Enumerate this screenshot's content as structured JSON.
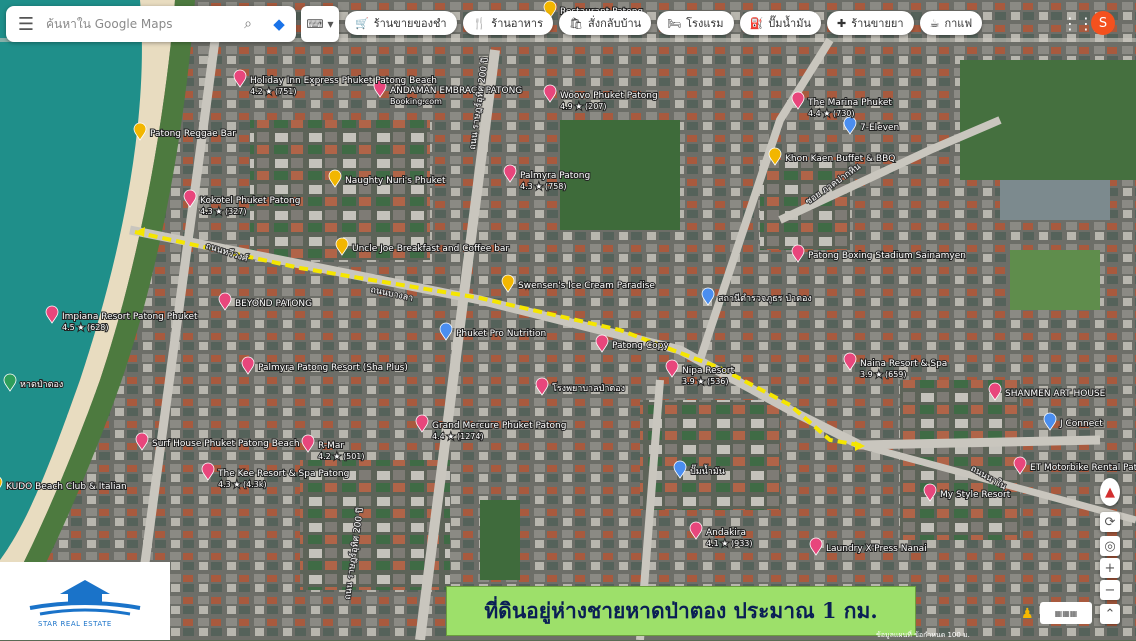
{
  "search": {
    "placeholder": "ค้นหาใน Google Maps"
  },
  "chips": [
    {
      "icon": "cart-icon",
      "glyph": "🛒",
      "label": "ร้านขายของชำ"
    },
    {
      "icon": "restaurant-icon",
      "glyph": "🍴",
      "label": "ร้านอาหาร"
    },
    {
      "icon": "takeout-icon",
      "glyph": "🛍",
      "label": "สั่งกลับบ้าน"
    },
    {
      "icon": "hotel-icon",
      "glyph": "🛏",
      "label": "โรงแรม"
    },
    {
      "icon": "gas-icon",
      "glyph": "⛽",
      "label": "ปั๊มน้ำมัน"
    },
    {
      "icon": "pharmacy-icon",
      "glyph": "✚",
      "label": "ร้านขายยา"
    },
    {
      "icon": "coffee-icon",
      "glyph": "☕",
      "label": "กาแฟ"
    }
  ],
  "user": {
    "initial": "S"
  },
  "banner": {
    "text": "ที่ดินอยู่ห่างชายหาดป่าตอง ประมาณ 1 กม."
  },
  "logo": {
    "text": "STAR REAL ESTATE"
  },
  "attribution": {
    "text": "ข้อมูลแผนที่  ข้อกำหนด  100 ม."
  },
  "colors": {
    "route": "#f5e600",
    "pin": "#e8467c",
    "pin_yellow": "#f2b600",
    "pin_blue": "#4a8ef0",
    "sea": "#1f8f8a",
    "sand": "#e8dcc0"
  },
  "map": {
    "places": [
      {
        "name": "Holiday Inn Express Phuket Patong Beach",
        "line2": "4.2 ★ (751)"
      },
      {
        "name": "ANDAMAN EMBRACE PATONG",
        "line2": "Booking.com"
      },
      {
        "name": "Woovo Phuket Patong",
        "line2": "4.9 ★ (207)"
      },
      {
        "name": "Patong Reggae Bar",
        "line2": ""
      },
      {
        "name": "Palmyra Patong",
        "line2": "4.3 ★ (758)"
      },
      {
        "name": "Naughty Nuri's Phuket",
        "line2": ""
      },
      {
        "name": "Kokotel Phuket Patong",
        "line2": "4.3 ★ (327)"
      },
      {
        "name": "Uncle Joe Breakfast and Coffee bar",
        "line2": ""
      },
      {
        "name": "Swensen's Ice Cream Paradise",
        "line2": ""
      },
      {
        "name": "BEYOND PATONG",
        "line2": ""
      },
      {
        "name": "Impiana Resort Patong Phuket",
        "line2": "4.5 ★ (628)"
      },
      {
        "name": "Phuket Pro Nutrition",
        "line2": ""
      },
      {
        "name": "Patong Copy",
        "line2": ""
      },
      {
        "name": "Nipa Resort",
        "line2": "3.9 ★ (536)"
      },
      {
        "name": "Palmyra Patong Resort (Sha Plus)",
        "line2": ""
      },
      {
        "name": "The Marina Phuket",
        "line2": "4.4 ★ (730)"
      },
      {
        "name": "7-Eleven",
        "line2": ""
      },
      {
        "name": "Khon Kaen Buffet & BBQ",
        "line2": ""
      },
      {
        "name": "Patong Boxing Stadium Sainamyen",
        "line2": ""
      },
      {
        "name": "Naina Resort & Spa",
        "line2": "3.9 ★ (659)"
      },
      {
        "name": "SHANMEN ART HOUSE",
        "line2": ""
      },
      {
        "name": "Surf House Phuket Patong Beach",
        "line2": ""
      },
      {
        "name": "R-Mar",
        "line2": "4.2 ★ (501)"
      },
      {
        "name": "Grand Mercure Phuket Patong",
        "line2": "4.4 ★ (1274)"
      },
      {
        "name": "The Kee Resort & Spa Patong",
        "line2": "4.3 ★ (4.3k)"
      },
      {
        "name": "KUDO Beach Club & Italian",
        "line2": ""
      },
      {
        "name": "Andakira",
        "line2": "4.1 ★ (933)"
      },
      {
        "name": "Laundry X'Press Nanai",
        "line2": ""
      },
      {
        "name": "My Style Resort",
        "line2": ""
      },
      {
        "name": "ET Motorbike Rental Patong",
        "line2": ""
      },
      {
        "name": "J Connect",
        "line2": ""
      },
      {
        "name": "Restaurant Patong",
        "line2": ""
      },
      {
        "name": "หาดป่าตอง",
        "line2": ""
      },
      {
        "name": "ปั๊มน้ำมัน",
        "line2": ""
      },
      {
        "name": "สถานีตำรวจภูธร ป่าตอง",
        "line2": ""
      },
      {
        "name": "โรงพยาบาลป่าตอง",
        "line2": ""
      }
    ],
    "roads": [
      {
        "name": "ถนนทวีวงศ์"
      },
      {
        "name": "ถนนบางลา"
      },
      {
        "name": "ถนน ราษฎร์อุทิศ 200 ปี"
      },
      {
        "name": "ถนน ราษฎร์อุทิศ 200 ปี "
      },
      {
        "name": "ถนนนาใน"
      },
      {
        "name": "ซอย ภาคปากหิน"
      }
    ]
  }
}
